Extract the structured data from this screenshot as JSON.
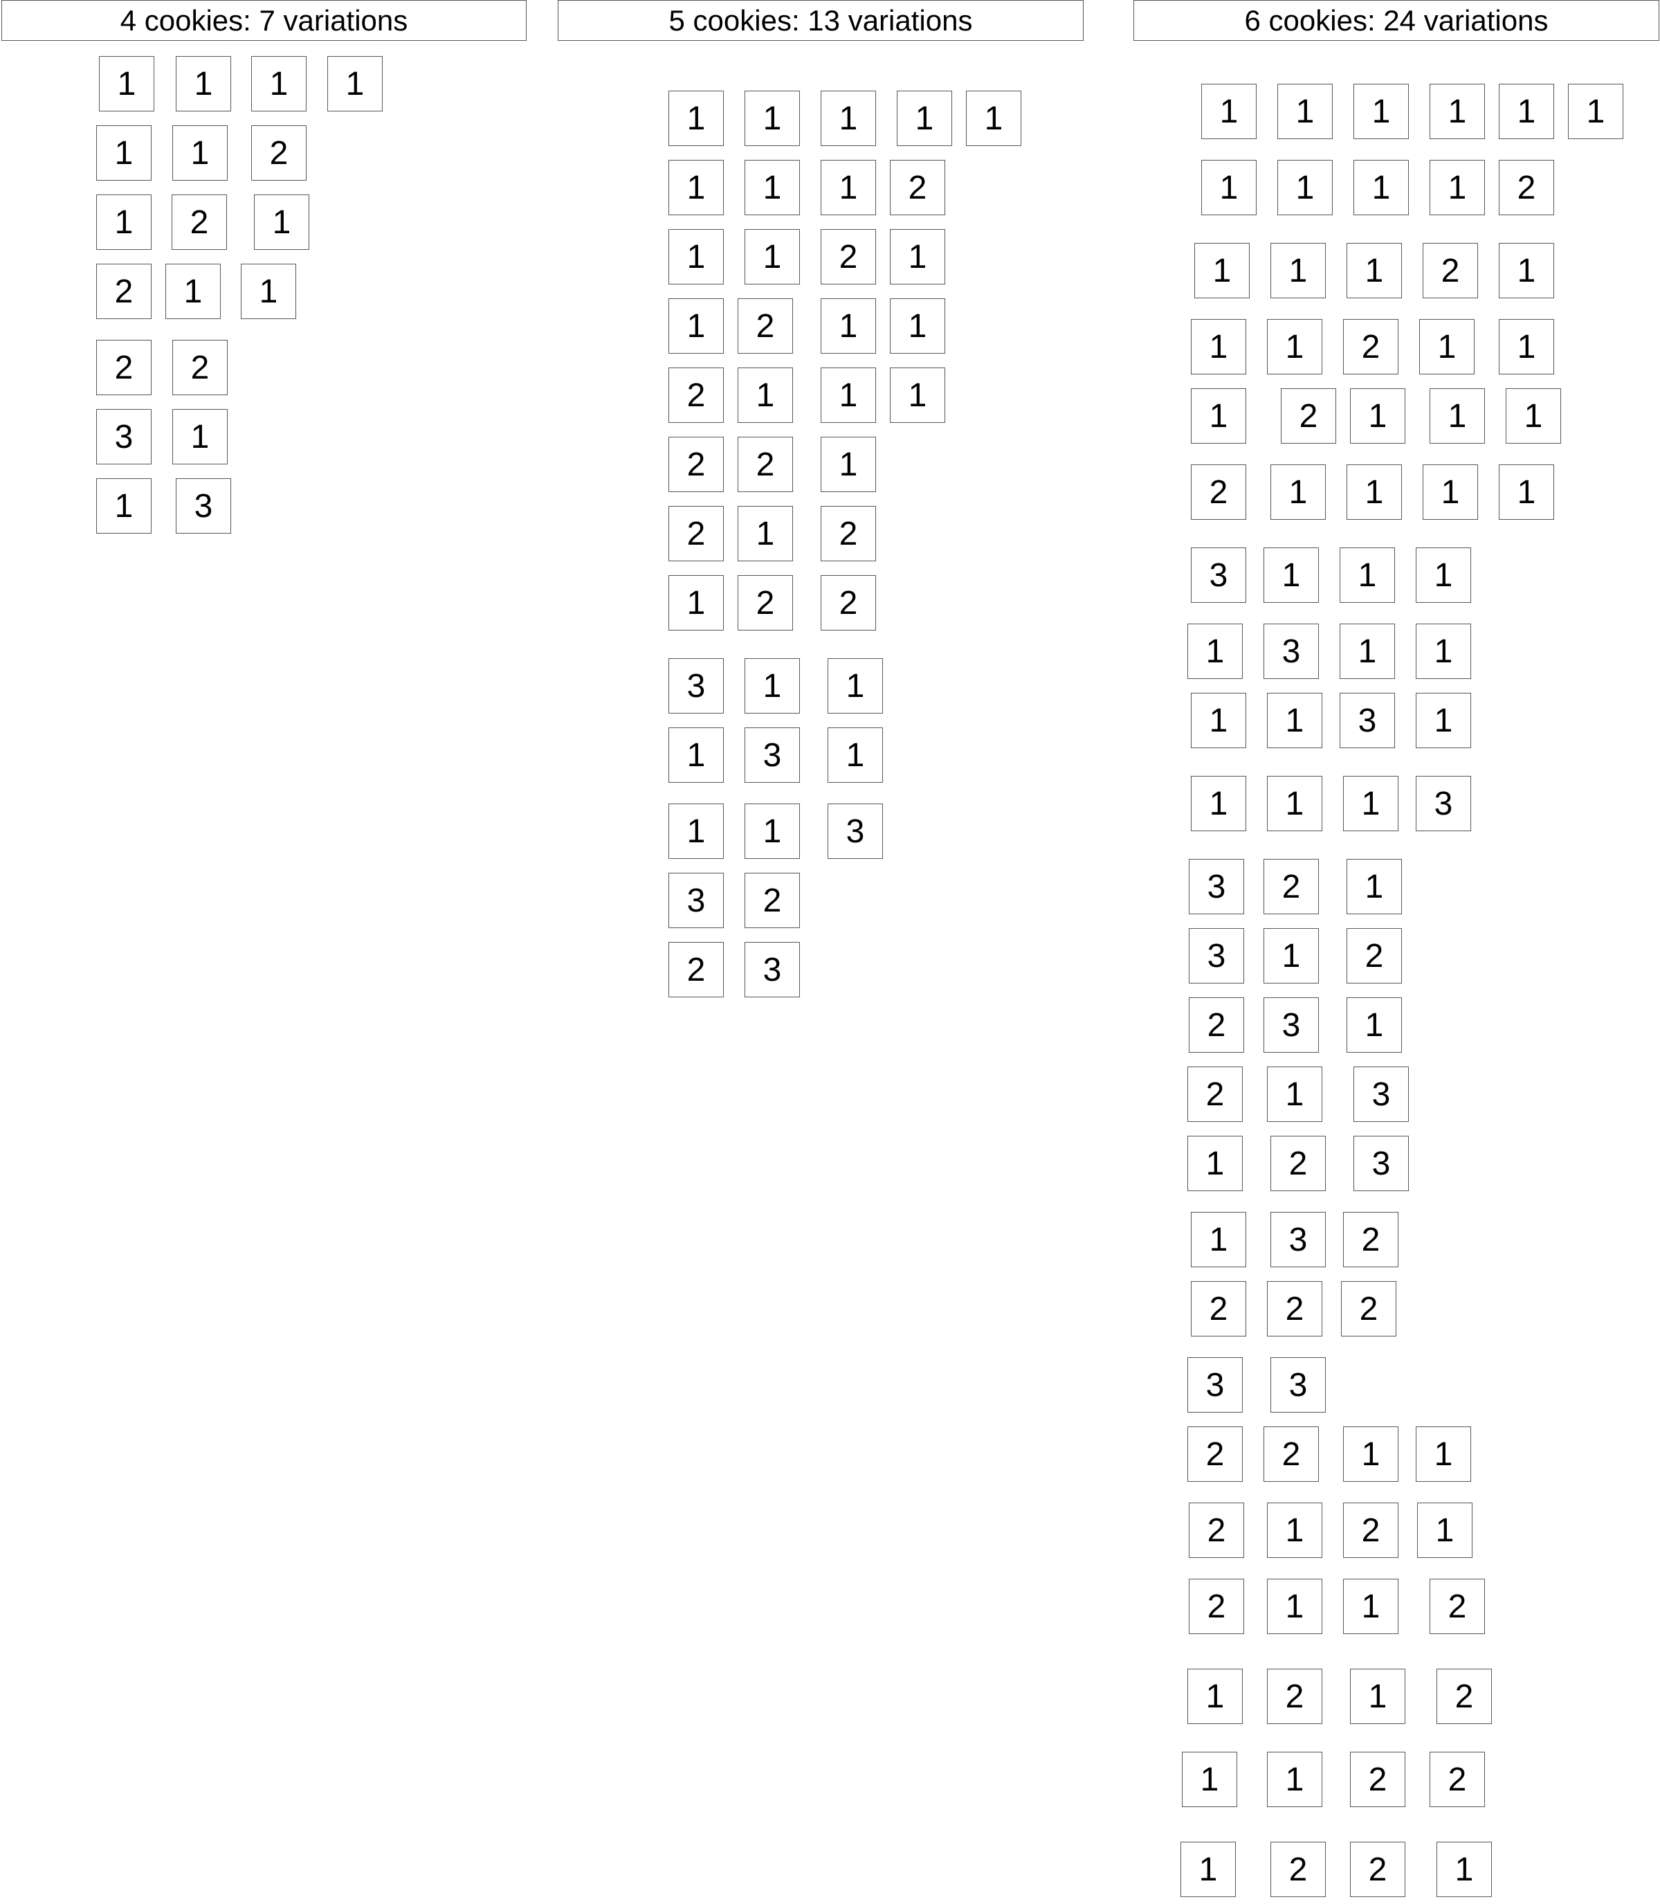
{
  "columns": [
    {
      "title": "4 cookies: 7 variations",
      "rows": [
        [
          1,
          1,
          1,
          1
        ],
        [
          1,
          1,
          2
        ],
        [
          1,
          2,
          1
        ],
        [
          2,
          1,
          1
        ],
        [
          2,
          2
        ],
        [
          3,
          1
        ],
        [
          1,
          3
        ]
      ]
    },
    {
      "title": "5 cookies: 13 variations",
      "rows": [
        [
          1,
          1,
          1,
          1,
          1
        ],
        [
          1,
          1,
          1,
          2
        ],
        [
          1,
          1,
          2,
          1
        ],
        [
          1,
          2,
          1,
          1
        ],
        [
          2,
          1,
          1,
          1
        ],
        [
          2,
          2,
          1
        ],
        [
          2,
          1,
          2
        ],
        [
          1,
          2,
          2
        ],
        [
          3,
          1,
          1
        ],
        [
          1,
          3,
          1
        ],
        [
          1,
          1,
          3
        ],
        [
          3,
          2
        ],
        [
          2,
          3
        ]
      ]
    },
    {
      "title": "6 cookies: 24 variations",
      "rows": [
        [
          1,
          1,
          1,
          1,
          1,
          1
        ],
        [
          1,
          1,
          1,
          1,
          2
        ],
        [
          1,
          1,
          1,
          2,
          1
        ],
        [
          1,
          1,
          2,
          1,
          1
        ],
        [
          1,
          2,
          1,
          1,
          1
        ],
        [
          2,
          1,
          1,
          1,
          1
        ],
        [
          3,
          1,
          1,
          1
        ],
        [
          1,
          3,
          1,
          1
        ],
        [
          1,
          1,
          3,
          1
        ],
        [
          1,
          1,
          1,
          3
        ],
        [
          3,
          2,
          1
        ],
        [
          3,
          1,
          2
        ],
        [
          2,
          3,
          1
        ],
        [
          2,
          1,
          3
        ],
        [
          1,
          2,
          3
        ],
        [
          1,
          3,
          2
        ],
        [
          2,
          2,
          2
        ],
        [
          3,
          3
        ],
        [
          2,
          2,
          1,
          1
        ],
        [
          2,
          1,
          2,
          1
        ],
        [
          2,
          1,
          1,
          2
        ],
        [
          1,
          2,
          1,
          2
        ],
        [
          1,
          1,
          2,
          2
        ],
        [
          1,
          2,
          2,
          1
        ]
      ]
    }
  ]
}
